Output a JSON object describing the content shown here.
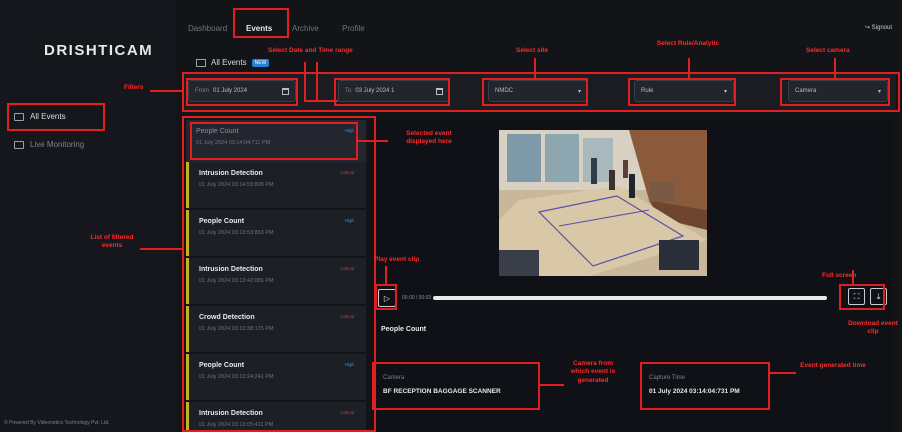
{
  "sidebar": {
    "logo": "DRISHTICAM",
    "items": [
      {
        "label": "All Events"
      },
      {
        "label": "Live Monitoring"
      }
    ],
    "footer": "© Powered By Videonetics Technology Pvt. Ltd."
  },
  "nav": {
    "tabs": [
      "Dashboard",
      "Events",
      "Archive",
      "Profile"
    ],
    "active": "Events",
    "signout": "Signout"
  },
  "page": {
    "title": "All Events",
    "badge": "NEW"
  },
  "filters": {
    "from_label": "From",
    "from_value": "01 July 2024",
    "to_label": "To",
    "to_value": "03 July 2024 1",
    "site": "NMDC",
    "rule": "Rule",
    "camera": "Camera"
  },
  "events": [
    {
      "title": "People Count",
      "time": "01 July 2024 03:14:04:711 PM",
      "tag": "High",
      "tag_color": "#3a8fe0",
      "selected": true
    },
    {
      "title": "Intrusion Detection",
      "time": "01 July 2024 03:14:59:808 PM",
      "tag": "Critical",
      "tag_color": "#e03030",
      "selected": false
    },
    {
      "title": "People Count",
      "time": "01 July 2024 03:13:53:863 PM",
      "tag": "High",
      "tag_color": "#3a8fe0",
      "selected": false
    },
    {
      "title": "Intrusion Detection",
      "time": "01 July 2024 03:13:42:081 PM",
      "tag": "Critical",
      "tag_color": "#e03030",
      "selected": false
    },
    {
      "title": "Crowd Detection",
      "time": "01 July 2024 03:13:38:175 PM",
      "tag": "Critical",
      "tag_color": "#e03030",
      "selected": false
    },
    {
      "title": "People Count",
      "time": "01 July 2024 03:13:24:241 PM",
      "tag": "High",
      "tag_color": "#3a8fe0",
      "selected": false
    },
    {
      "title": "Intrusion Detection",
      "time": "01 July 2024 03:13:05:411 PM",
      "tag": "Critical",
      "tag_color": "#e03030",
      "selected": false
    }
  ],
  "player": {
    "timecode": "00:00 / 00:03",
    "event_name": "People Count",
    "progress": 0.97
  },
  "details": {
    "camera_label": "Camera",
    "camera_value": "BF RECEPTION BAGGAGE SCANNER",
    "capture_label": "Capture Time",
    "capture_value": "01 July 2024 03:14:04:731 PM"
  },
  "annotations": {
    "filters": "Filters",
    "date_range": "Select Date and Time range",
    "site": "Select site",
    "rule": "Select Rule/Analytic",
    "camera": "Select camera",
    "selected_event": "Selected event displayed here",
    "event_list": "List of filtered events",
    "play": "Play event clip",
    "full_screen": "Full screen",
    "download": "Download event clip",
    "camera_source": "Camera from which event is generated",
    "event_time": "Event generated time"
  },
  "colors": {
    "annotation": "#e02020",
    "accent": "#2a7fd6",
    "event_marker": "#c6b31d"
  }
}
